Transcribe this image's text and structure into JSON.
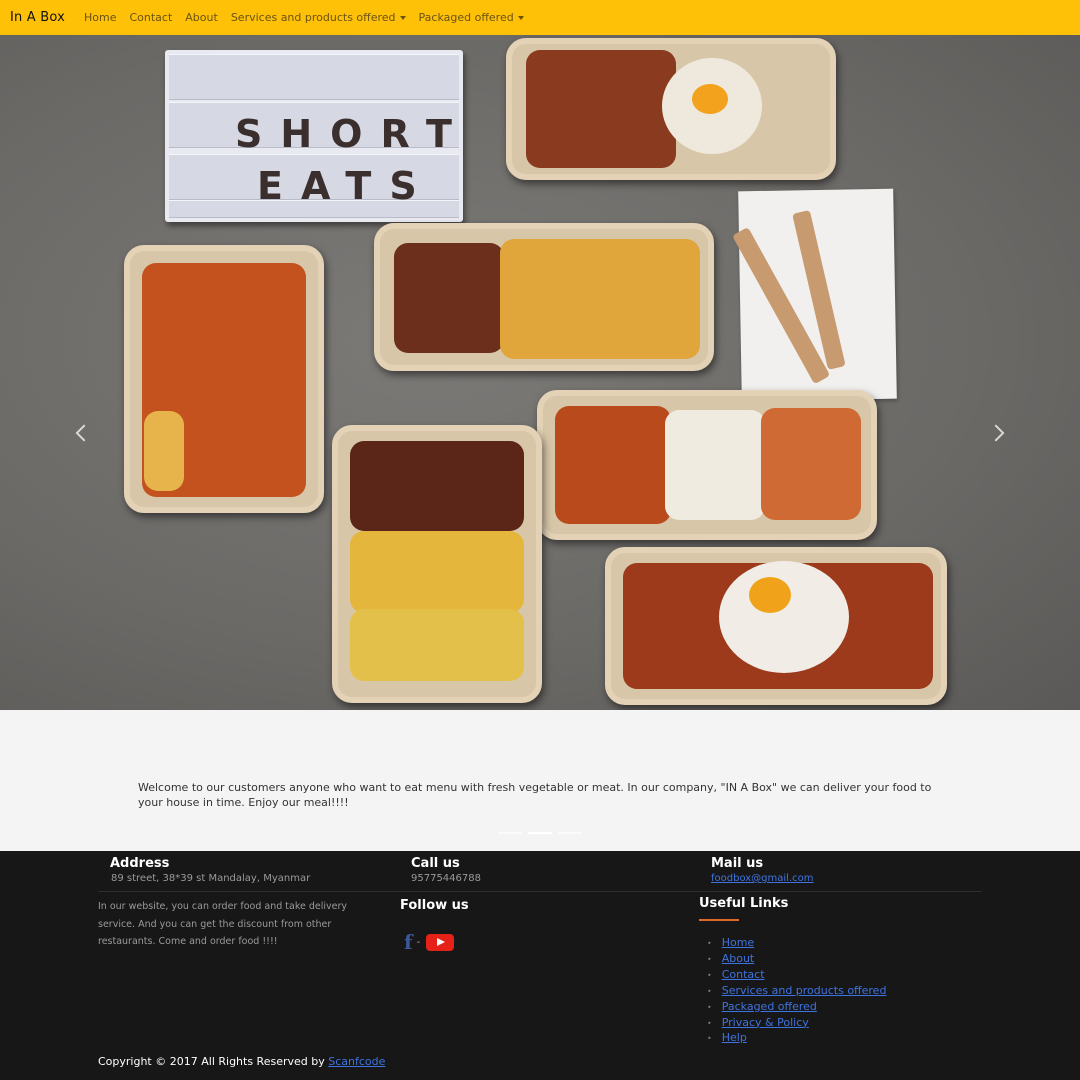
{
  "nav": {
    "brand": "In A Box",
    "links": [
      "Home",
      "Contact",
      "About"
    ],
    "dropdowns": [
      "Services and products offered",
      "Packaged offered"
    ]
  },
  "hero": {
    "lightbox_line1": "SHORT",
    "lightbox_line2": "EATS"
  },
  "caption": {
    "welcome": "Welcome to our customers anyone who want to eat menu with fresh vegetable or meat. In our company, \"IN A Box\" we can deliver your food to your house in time. Enjoy our meal!!!!"
  },
  "footer": {
    "address_title": "Address",
    "address_value": "89 street, 38*39 st Mandalay, Myanmar",
    "call_title": "Call us",
    "call_value": "95775446788",
    "mail_title": "Mail us",
    "mail_value": "foodbox@gmail.com",
    "about": "In our website, you can order food and take delivery service. And you can get the discount from other restaurants. Come and order food !!!!",
    "follow_title": "Follow us",
    "social_separator": "-",
    "useful_title": "Useful Links",
    "useful_links": [
      "Home",
      "About",
      "Contact",
      "Services and products offered",
      "Packaged offered",
      "Privacy & Policy",
      "Help"
    ],
    "copyright_prefix": "Copyright © 2017 All Rights Reserved by",
    "copyright_link": "Scanfcode"
  },
  "icons": [
    "caret-down-icon",
    "carousel-prev-icon",
    "carousel-next-icon",
    "facebook-icon",
    "youtube-icon"
  ],
  "colors": {
    "navbar": "#ffc107",
    "footer": "#171717",
    "link": "#3f73e0",
    "accent": "#e0662a"
  }
}
